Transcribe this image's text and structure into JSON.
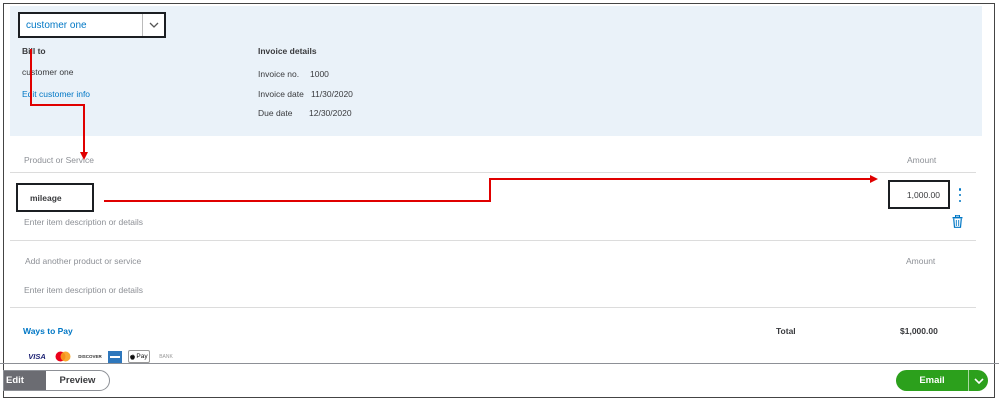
{
  "customer_select": {
    "value": "customer one"
  },
  "bill_to": {
    "heading": "Bill to",
    "name": "customer one",
    "edit_link": "Edit customer info"
  },
  "invoice_details": {
    "heading": "Invoice details",
    "invoice_no_label": "Invoice no.",
    "invoice_no": "1000",
    "invoice_date_label": "Invoice date",
    "invoice_date": "11/30/2020",
    "due_date_label": "Due date",
    "due_date": "12/30/2020"
  },
  "line_items": {
    "col_product": "Product or Service",
    "col_amount": "Amount",
    "items": [
      {
        "product": "mileage",
        "description_placeholder": "Enter item description or details",
        "amount": "1,000.00"
      }
    ],
    "add_placeholder": "Add another product or service",
    "add_amount_placeholder": "Amount",
    "add_description_placeholder": "Enter item description or details"
  },
  "footer": {
    "ways_to_pay": "Ways to Pay",
    "pay_icons": [
      "VISA",
      "mastercard-icon",
      "DISCOVER",
      "amex-icon",
      "Pay",
      "BANK"
    ],
    "total_label": "Total",
    "total_value": "$1,000.00"
  },
  "actions": {
    "edit": "Edit",
    "preview": "Preview",
    "email": "Email"
  },
  "colors": {
    "link_blue": "#0077c5",
    "green": "#2ca01c",
    "annotation_red": "#e00000",
    "header_bg": "#eaf2f9"
  }
}
